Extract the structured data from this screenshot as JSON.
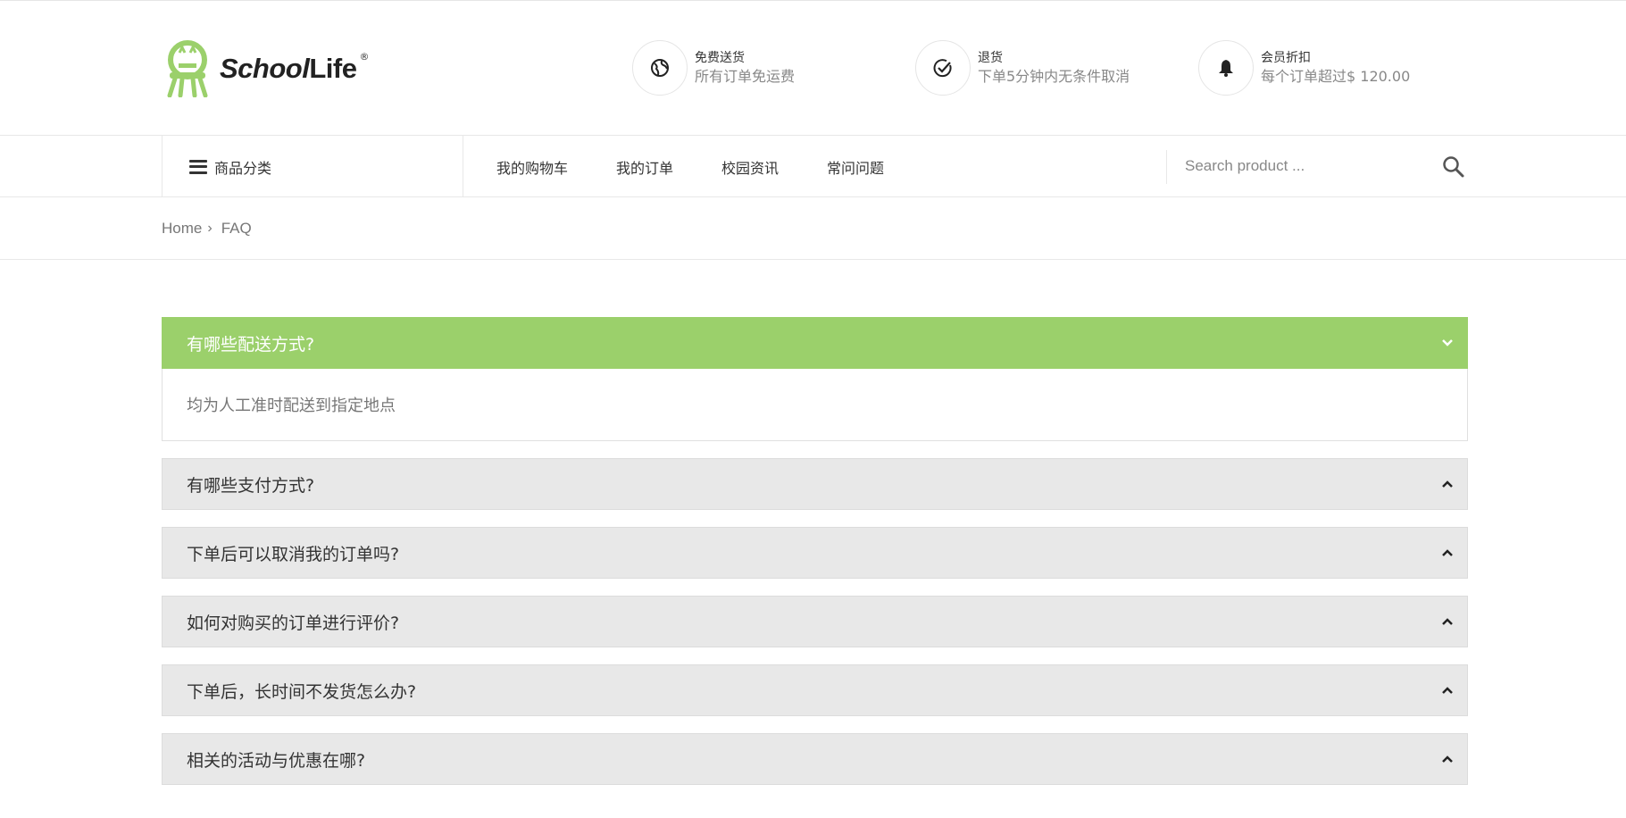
{
  "brand": {
    "name_part1": "School",
    "name_part2": "Life",
    "reg_mark": "®",
    "accent": "#9bd06b"
  },
  "features": [
    {
      "title": "免费送货",
      "subtitle": "所有订单免运费",
      "icon": "globe-icon"
    },
    {
      "title": "退货",
      "subtitle": "下单5分钟内无条件取消",
      "icon": "check-circle-icon"
    },
    {
      "title": "会员折扣",
      "subtitle": "每个订单超过$ 120.00",
      "icon": "bell-icon"
    }
  ],
  "nav": {
    "category_label": "商品分类",
    "links": [
      "我的购物车",
      "我的订单",
      "校园资讯",
      "常问问题"
    ]
  },
  "search": {
    "placeholder": "Search product ..."
  },
  "breadcrumb": {
    "home": "Home",
    "separator": "›",
    "current": "FAQ"
  },
  "faq": [
    {
      "question": "有哪些配送方式?",
      "answer": "均为人工准时配送到指定地点",
      "open": true
    },
    {
      "question": "有哪些支付方式?",
      "open": false
    },
    {
      "question": "下单后可以取消我的订单吗?",
      "open": false
    },
    {
      "question": "如何对购买的订单进行评价?",
      "open": false
    },
    {
      "question": "下单后，长时间不发货怎么办?",
      "open": false
    },
    {
      "question": "相关的活动与优惠在哪?",
      "open": false
    }
  ]
}
